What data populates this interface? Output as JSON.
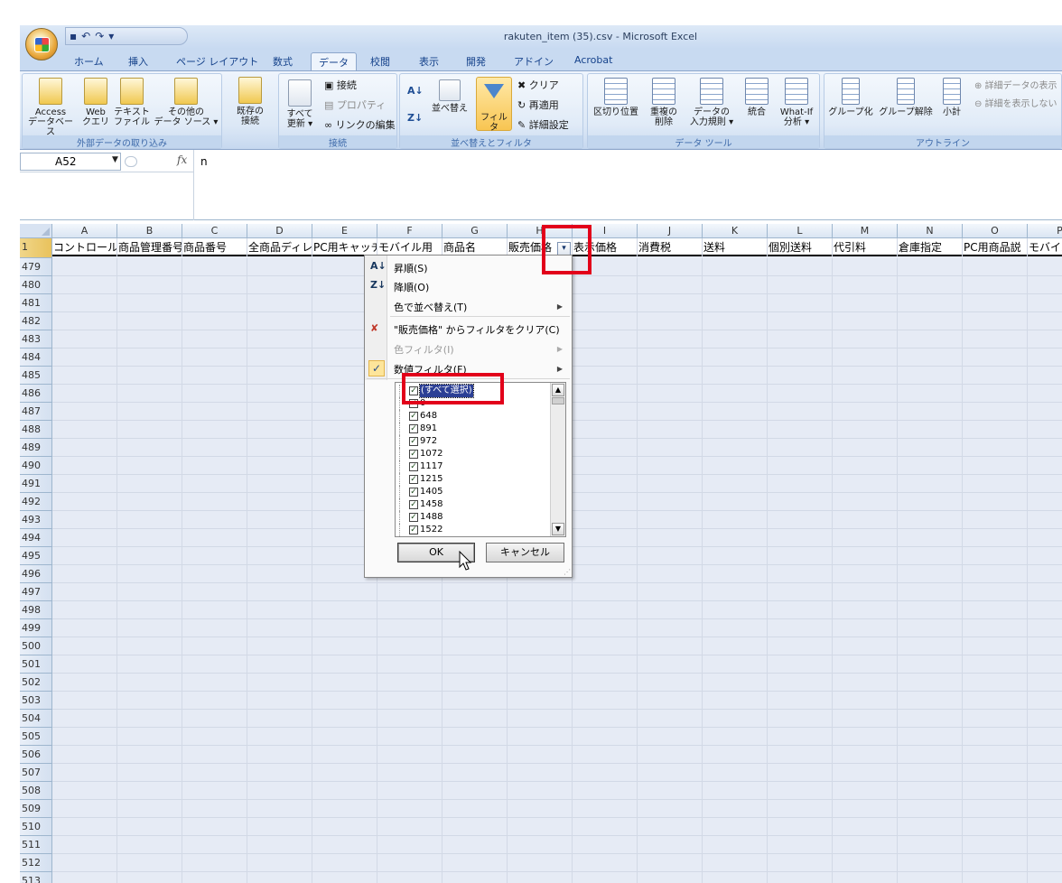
{
  "window": {
    "title": "rakuten_item (35).csv - Microsoft Excel"
  },
  "qat": {
    "save": "▪",
    "undo": "↶",
    "redo": "↷",
    "more": "▾"
  },
  "tabs": [
    "ホーム",
    "挿入",
    "ページ レイアウト",
    "数式",
    "データ",
    "校閲",
    "表示",
    "開発",
    "アドイン",
    "Acrobat"
  ],
  "active_tab": "データ",
  "ribbon": {
    "groups": {
      "external": "外部データの取り込み",
      "connections": "接続",
      "sortfilter": "並べ替えとフィルタ",
      "datatools": "データ ツール",
      "outline": "アウトライン"
    },
    "buttons": {
      "access": [
        "Access",
        "データベース"
      ],
      "web": [
        "Web",
        "クエリ"
      ],
      "text": [
        "テキスト",
        "ファイル"
      ],
      "other": [
        "その他の",
        "データ ソース ▾"
      ],
      "existing": [
        "既存の",
        "接続"
      ],
      "refresh": [
        "すべて",
        "更新 ▾"
      ],
      "connect": "接続",
      "properties": "プロパティ",
      "editlinks": "リンクの編集",
      "sort": "並べ替え",
      "filter": "フィルタ",
      "clear": "クリア",
      "reapply": "再適用",
      "advanced": "詳細設定",
      "texttocols": "区切り位置",
      "dupes": [
        "重複の",
        "削除"
      ],
      "validation": [
        "データの",
        "入力規則 ▾"
      ],
      "consolidate": "統合",
      "whatif": [
        "What-If",
        "分析 ▾"
      ],
      "group": "グループ化",
      "ungroup": "グループ解除",
      "subtotal": "小計",
      "showdetail": "詳細データの表示",
      "hidedetail": "詳細を表示しない"
    }
  },
  "formula_bar": {
    "cell": "A52",
    "fx": "fx",
    "value": "n"
  },
  "columns": [
    "A",
    "B",
    "C",
    "D",
    "E",
    "F",
    "G",
    "H",
    "I",
    "J",
    "K",
    "L",
    "M",
    "N",
    "O",
    "P"
  ],
  "header_row": {
    "number": "1",
    "cells": [
      "コントロール",
      "商品管理番号",
      "商品番号",
      "全商品ディレ",
      "PC用キャッチ",
      "モバイル用",
      "商品名",
      "販売価格",
      "表示価格",
      "消費税",
      "送料",
      "個別送料",
      "代引料",
      "倉庫指定",
      "PC用商品説",
      "モバイル"
    ]
  },
  "rows": [
    "479",
    "480",
    "481",
    "482",
    "483",
    "484",
    "485",
    "486",
    "487",
    "488",
    "489",
    "490",
    "491",
    "492",
    "493",
    "494",
    "495",
    "496",
    "497",
    "498",
    "499",
    "500",
    "501",
    "502",
    "503",
    "504",
    "505",
    "506",
    "507",
    "508",
    "509",
    "510",
    "511",
    "512",
    "513"
  ],
  "filter_menu": {
    "sort_asc": "昇順(S)",
    "sort_desc": "降順(O)",
    "sort_color": "色で並べ替え(T)",
    "clear_filter": "\"販売価格\" からフィルタをクリア(C)",
    "color_filter": "色フィルタ(I)",
    "number_filter": "数値フィルタ(F)",
    "items": [
      {
        "label": "(すべて選択)",
        "checked": true
      },
      {
        "label": "0",
        "checked": true
      },
      {
        "label": "648",
        "checked": true
      },
      {
        "label": "891",
        "checked": true
      },
      {
        "label": "972",
        "checked": true
      },
      {
        "label": "1072",
        "checked": true
      },
      {
        "label": "1117",
        "checked": true
      },
      {
        "label": "1215",
        "checked": true
      },
      {
        "label": "1405",
        "checked": true
      },
      {
        "label": "1458",
        "checked": true
      },
      {
        "label": "1488",
        "checked": true
      },
      {
        "label": "1522",
        "checked": true
      }
    ],
    "ok": "OK",
    "cancel": "キャンセル"
  },
  "colors": {
    "highlight": "#e2001a",
    "ribbon": "#dce8f6",
    "grid": "#e6ebf5"
  }
}
